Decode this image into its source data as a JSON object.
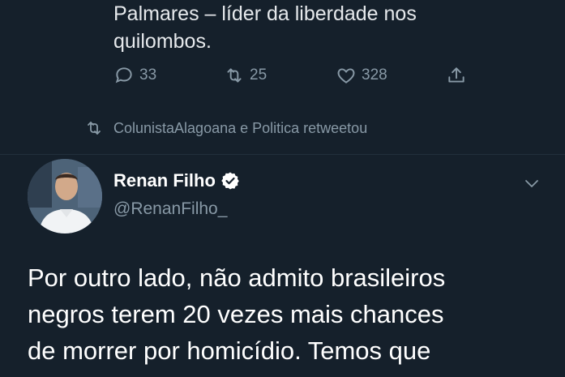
{
  "previous_tweet": {
    "text_lines": [
      "Palmares – líder da liberdade nos",
      "quilombos."
    ],
    "actions": {
      "replies": "33",
      "retweets": "25",
      "likes": "328"
    }
  },
  "retweet_notice": "ColunistaAlagoana e Politica retweetou",
  "tweet": {
    "author_name": "Renan Filho",
    "author_handle": "@RenanFilho_",
    "text_lines": [
      "Por outro lado, não admito brasileiros",
      "negros terem 20 vezes mais chances",
      "de morrer por homicídio. Temos que"
    ]
  },
  "colors": {
    "background": "#15202b",
    "secondary_text": "#8899a6",
    "verified_badge": "#ffffff"
  }
}
